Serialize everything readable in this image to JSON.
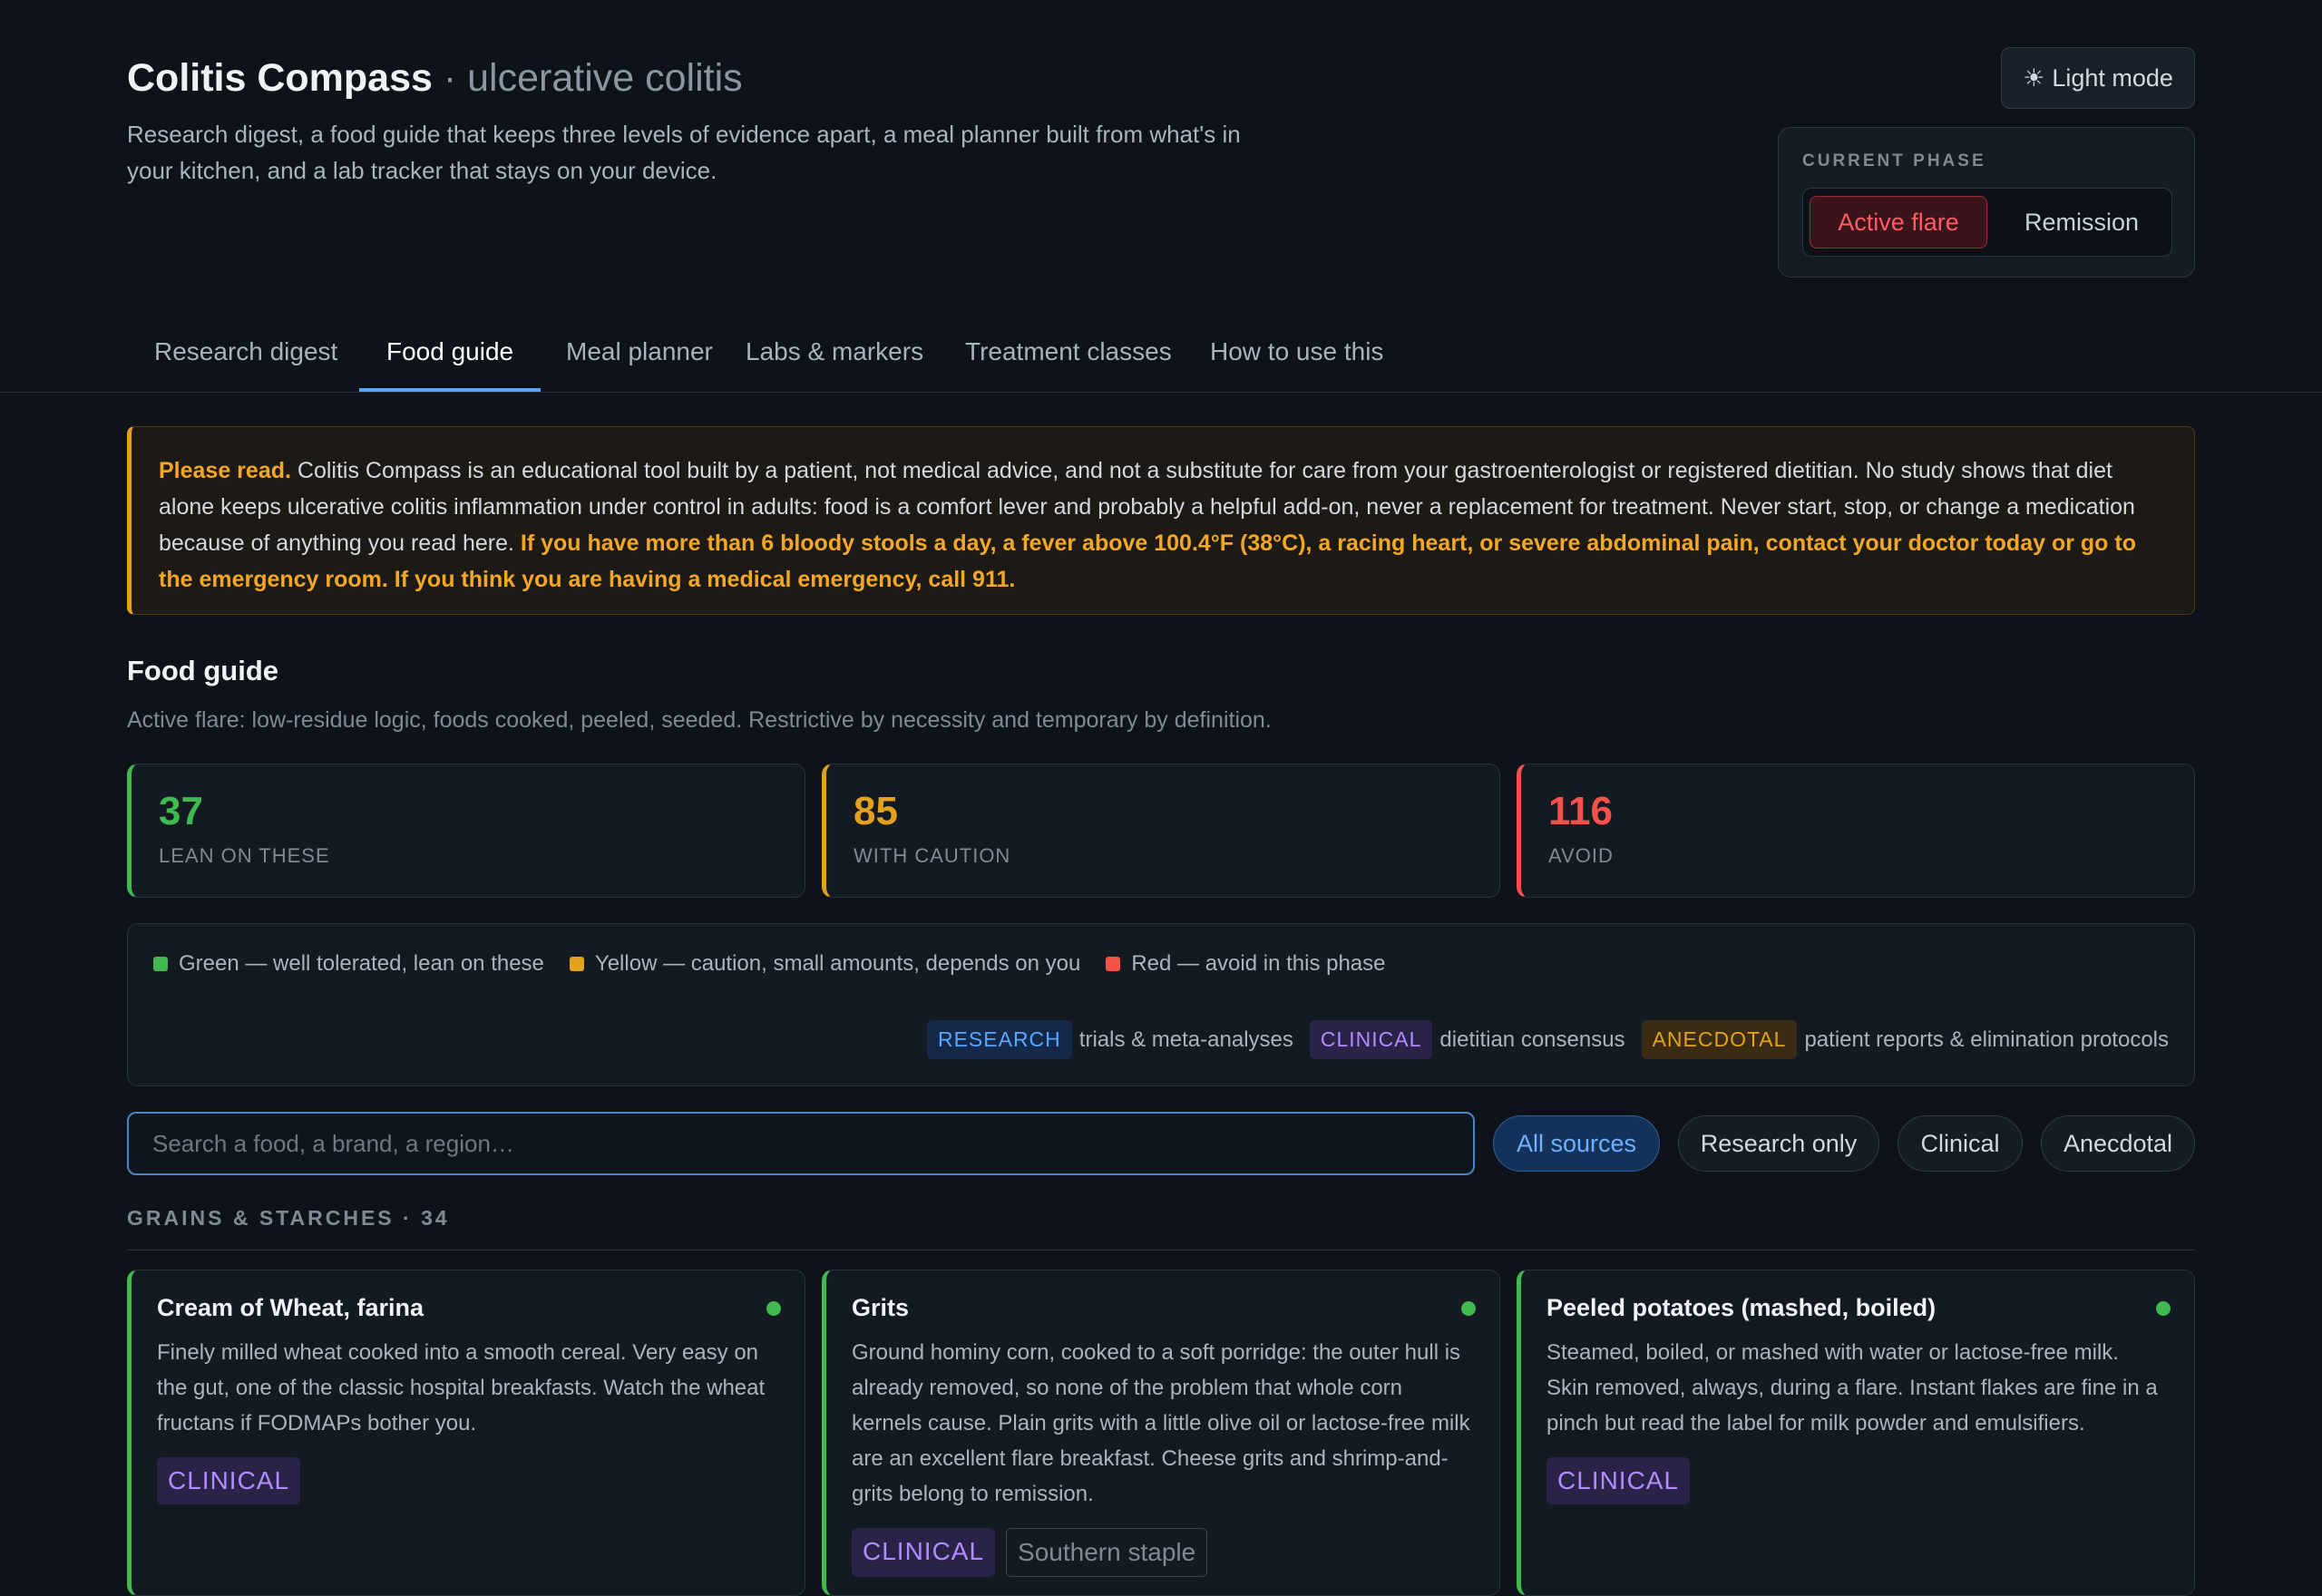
{
  "header": {
    "title": "Colitis Compass",
    "subtitle": "· ulcerative colitis",
    "description": "Research digest, a food guide that keeps three levels of evidence apart, a meal planner built from what's in your kitchen, and a lab tracker that stays on your device.",
    "light_mode_label": "Light mode",
    "light_mode_icon": "sun-icon"
  },
  "phase": {
    "label": "CURRENT PHASE",
    "options": [
      "Active flare",
      "Remission"
    ],
    "selected": "Active flare"
  },
  "tabs": [
    {
      "label": "Research digest"
    },
    {
      "label": "Food guide"
    },
    {
      "label": "Meal planner"
    },
    {
      "label": "Labs & markers"
    },
    {
      "label": "Treatment classes"
    },
    {
      "label": "How to use this"
    }
  ],
  "active_tab": "Food guide",
  "notice": {
    "lead": "Please read.",
    "body": " Colitis Compass is an educational tool built by a patient, not medical advice, and not a substitute for care from your gastroenterologist or registered dietitian. No study shows that diet alone keeps ulcerative colitis inflammation under control in adults: food is a comfort lever and probably a helpful add-on, never a replacement for treatment. Never start, stop, or change a medication because of anything you read here. ",
    "warning": "If you have more than 6 bloody stools a day, a fever above 100.4°F (38°C), a racing heart, or severe abdominal pain, contact your doctor today or go to the emergency room. If you think you are having a medical emergency, call 911."
  },
  "section": {
    "title": "Food guide",
    "description": "Active flare: low-residue logic, foods cooked, peeled, seeded. Restrictive by necessity and temporary by definition."
  },
  "stats": [
    {
      "value": "37",
      "label": "LEAN ON THESE",
      "color": "#3fb950"
    },
    {
      "value": "85",
      "label": "WITH CAUTION",
      "color": "#e3a11f"
    },
    {
      "value": "116",
      "label": "AVOID",
      "color": "#f85149"
    }
  ],
  "legend": {
    "colors": [
      {
        "label": "Green — well tolerated, lean on these",
        "color": "#3fb950"
      },
      {
        "label": "Yellow — caution, small amounts, depends on you",
        "color": "#e3a11f"
      },
      {
        "label": "Red — avoid in this phase",
        "color": "#f85149"
      }
    ],
    "sources": [
      {
        "tag": "RESEARCH",
        "text": "trials & meta-analyses"
      },
      {
        "tag": "CLINICAL",
        "text": "dietitian consensus"
      },
      {
        "tag": "ANECDOTAL",
        "text": "patient reports & elimination protocols"
      }
    ]
  },
  "search": {
    "placeholder": "Search a food, a brand, a region…",
    "value": ""
  },
  "filters": [
    {
      "label": "All sources",
      "active": true
    },
    {
      "label": "Research only",
      "active": false
    },
    {
      "label": "Clinical",
      "active": false
    },
    {
      "label": "Anecdotal",
      "active": false
    }
  ],
  "category": {
    "heading": "GRAINS & STARCHES · 34"
  },
  "cards": [
    {
      "title": "Cream of Wheat, farina",
      "status": "green",
      "description": "Finely milled wheat cooked into a smooth cereal. Very easy on the gut, one of the classic hospital breakfasts. Watch the wheat fructans if FODMAPs bother you.",
      "tags": [
        "CLINICAL"
      ]
    },
    {
      "title": "Grits",
      "status": "green",
      "description": "Ground hominy corn, cooked to a soft porridge: the outer hull is already removed, so none of the problem that whole corn kernels cause. Plain grits with a little olive oil or lactose-free milk are an excellent flare breakfast. Cheese grits and shrimp-and-grits belong to remission.",
      "tags": [
        "CLINICAL",
        "Southern staple"
      ]
    },
    {
      "title": "Peeled potatoes (mashed, boiled)",
      "status": "green",
      "description": "Steamed, boiled, or mashed with water or lactose-free milk. Skin removed, always, during a flare. Instant flakes are fine in a pinch but read the label for milk powder and emulsifiers.",
      "tags": [
        "CLINICAL"
      ]
    }
  ]
}
